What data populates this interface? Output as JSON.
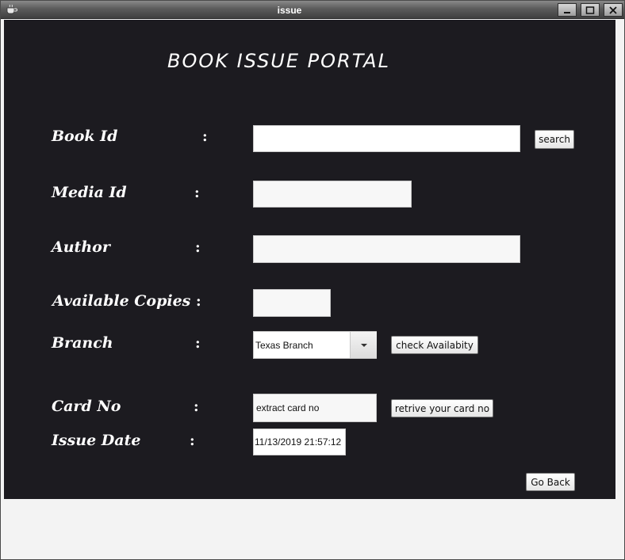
{
  "window": {
    "title": "issue",
    "controls": {
      "minimize": "minimize-icon",
      "maximize": "maximize-icon",
      "close": "close-icon"
    },
    "app_icon": "java-cup-icon"
  },
  "portal": {
    "heading": "BOOK ISSUE PORTAL",
    "colors": {
      "panel_background": "#1c1b20",
      "label_color": "#ffffff"
    }
  },
  "form": {
    "book_id": {
      "label": "Book Id",
      "colon": ":",
      "value": ""
    },
    "search_button": "search",
    "media_id": {
      "label": "Media Id",
      "colon": ":",
      "value": ""
    },
    "author": {
      "label": "Author",
      "colon": ":",
      "value": ""
    },
    "available_copies": {
      "label": "Available Copies",
      "colon": ":",
      "value": ""
    },
    "branch": {
      "label": "Branch",
      "colon": ":",
      "selected": "Texas Branch"
    },
    "check_availability_button": "check Availabity",
    "card_no": {
      "label": "Card No",
      "colon": ":",
      "value": "extract card no"
    },
    "retrieve_card_button": "retrive your card no",
    "issue_date": {
      "label": "Issue Date",
      "colon": ":",
      "value": "11/13/2019 21:57:12"
    },
    "go_back_button": "Go Back"
  }
}
